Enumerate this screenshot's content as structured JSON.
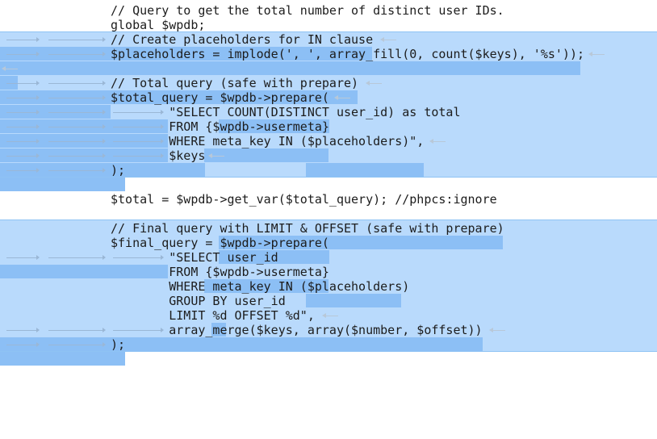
{
  "editor": {
    "lines": [
      "// Query to get the total number of distinct user IDs.",
      "global $wpdb;",
      "// Create placeholders for IN clause",
      "$placeholders = implode(', ', array_fill(0, count($keys), '%s'));",
      "",
      "// Total query (safe with prepare)",
      "$total_query = $wpdb->prepare(",
      "        \"SELECT COUNT(DISTINCT user_id) as total",
      "        FROM {$wpdb->usermeta}",
      "        WHERE meta_key IN ($placeholders)\",",
      "        $keys",
      ");",
      "",
      "$total = $wpdb->get_var($total_query); //phpcs:ignore",
      "",
      "// Final query with LIMIT & OFFSET (safe with prepare)",
      "$final_query = $wpdb->prepare(",
      "        \"SELECT user_id",
      "        FROM {$wpdb->usermeta}",
      "        WHERE meta_key IN ($placeholders)",
      "        GROUP BY user_id",
      "        LIMIT %d OFFSET %d\",",
      "        array_merge($keys, array($number, $offset))",
      ");"
    ]
  },
  "colors": {
    "selection_band": "#b9dafc",
    "selection_text": "#8cbff5",
    "text": "#1c1c1c",
    "whitespace_marker": "#b8c8d8"
  }
}
